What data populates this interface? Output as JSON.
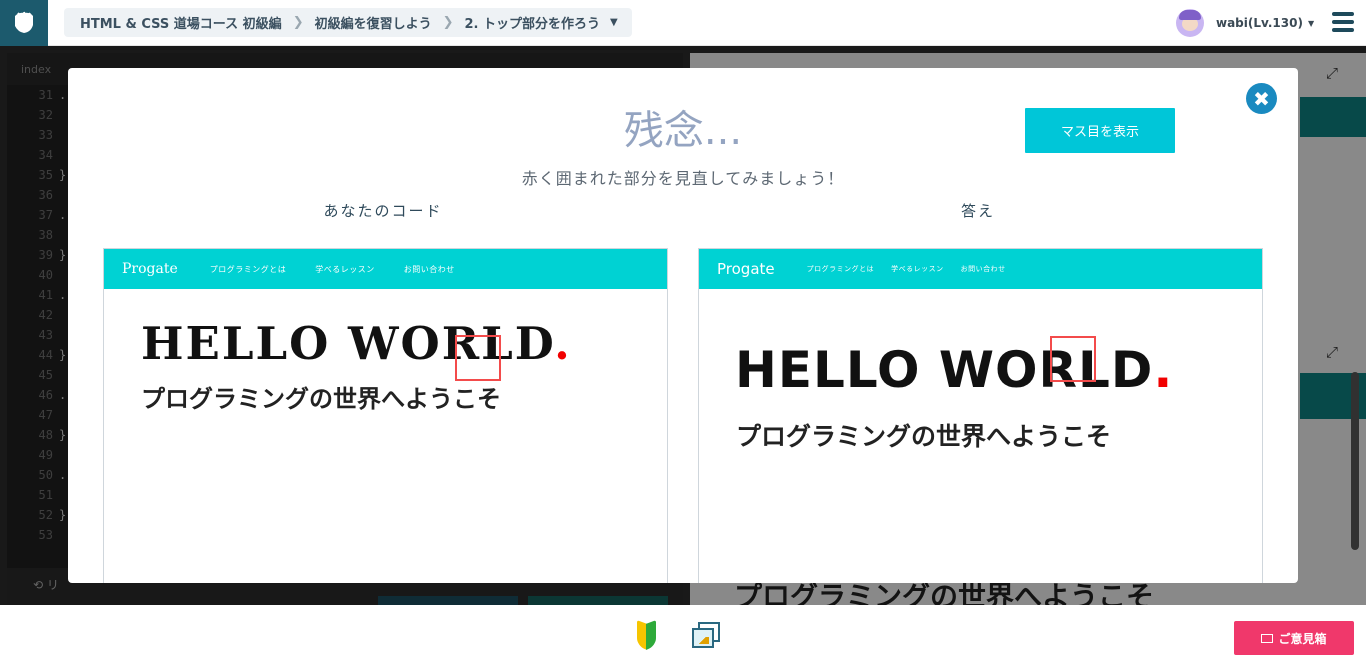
{
  "header": {
    "breadcrumb": [
      "HTML & CSS 道場コース 初級編",
      "初級編を復習しよう",
      "2. トップ部分を作ろう"
    ],
    "user_name": "wabi(Lv.130)"
  },
  "editor": {
    "tab_name": "index",
    "line_numbers": [
      "31",
      "32",
      "33",
      "34",
      "35",
      "36",
      "37",
      "38",
      "39",
      "40",
      "41",
      "42",
      "43",
      "44",
      "45",
      "46",
      "47",
      "48",
      "49",
      "50",
      "51",
      "52",
      "53"
    ],
    "code_lines": [
      ".",
      "",
      "",
      "",
      "}",
      "",
      ".",
      "",
      "}",
      "",
      ".",
      "",
      "",
      "}",
      "",
      ".",
      "",
      "}",
      "",
      ".",
      "",
      "}",
      ""
    ],
    "reset_label": "リ"
  },
  "background": {
    "preview_heading": "プログラミングの世界へようこそ"
  },
  "modal": {
    "title": "残念...",
    "grid_button": "マス目を表示",
    "subtitle": "赤く囲まれた部分を見直してみましょう！",
    "your_code_label": "あなたのコード",
    "answer_label": "答え",
    "close_symbol": "✖"
  },
  "preview_left": {
    "brand": "Progate",
    "nav": [
      "プログラミングとは",
      "学べるレッスン",
      "お問い合わせ"
    ],
    "hello": "HELLO WORLD",
    "dot": ".",
    "sub": "プログラミングの世界へようこそ"
  },
  "preview_right": {
    "brand": "Progate",
    "nav": [
      "プログラミングとは",
      "学べるレッスン",
      "お問い合わせ"
    ],
    "hello": "HELLO WORLD",
    "dot": ".",
    "sub": "プログラミングの世界へようこそ"
  },
  "bottom": {
    "feedback_label": "ご意見箱"
  },
  "colors": {
    "accent": "#00c6d8",
    "diff_box": "#f34b4b",
    "feedback": "#f0386b",
    "title": "#94a4c1"
  }
}
